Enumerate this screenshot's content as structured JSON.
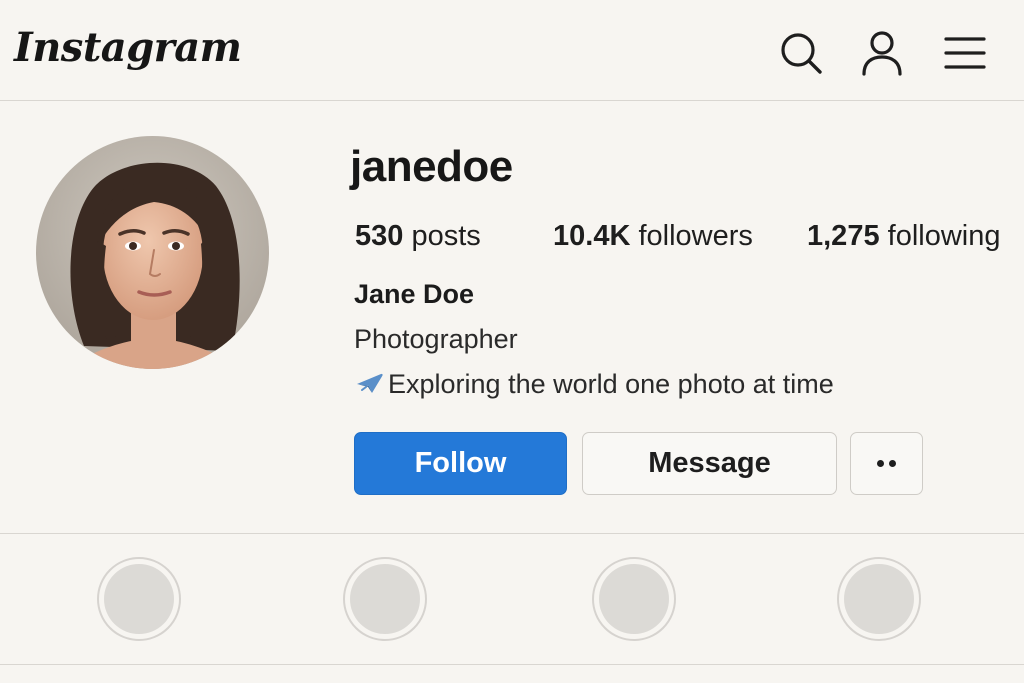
{
  "header": {
    "logo_text": "Instagram",
    "icons": [
      "search-icon",
      "profile-icon",
      "menu-icon"
    ]
  },
  "profile": {
    "username": "janedoe",
    "stats": {
      "posts_count": "530",
      "posts_label": "posts",
      "followers_count": "10.4K",
      "followers_label": "followers",
      "following_count": "1,275",
      "following_label": "following"
    },
    "display_name": "Jane Doe",
    "category": "Photographer",
    "bio_icon": "airplane-icon",
    "bio": "Exploring the world one photo at time"
  },
  "actions": {
    "follow_label": "Follow",
    "message_label": "Message",
    "more_icon": "more-dots-icon"
  },
  "highlights": [
    {
      "name": "highlight-1"
    },
    {
      "name": "highlight-2"
    },
    {
      "name": "highlight-3"
    },
    {
      "name": "highlight-4"
    }
  ],
  "colors": {
    "accent": "#2479d8",
    "background": "#f7f5f1",
    "border": "#d9d6d1"
  }
}
